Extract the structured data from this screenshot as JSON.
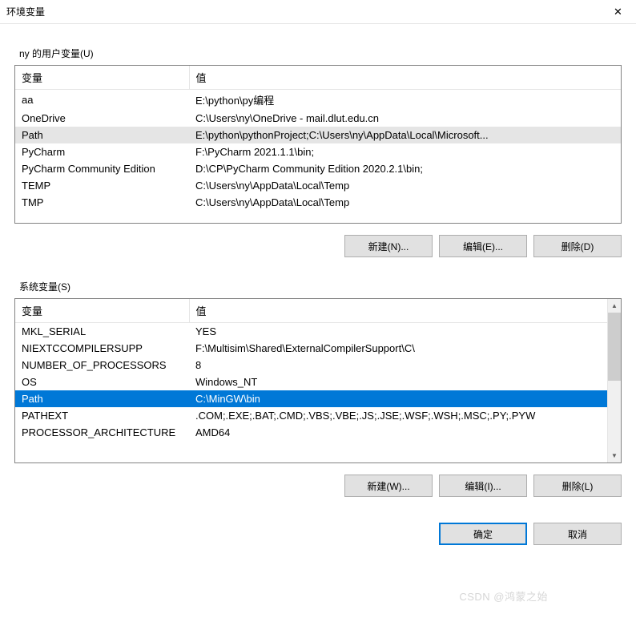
{
  "window": {
    "title": "环境变量"
  },
  "userSection": {
    "label": "ny 的用户变量(U)",
    "headers": {
      "var": "变量",
      "val": "值"
    },
    "rows": [
      {
        "var": "aa",
        "val": "E:\\python\\py编程",
        "selected": false
      },
      {
        "var": "OneDrive",
        "val": "C:\\Users\\ny\\OneDrive - mail.dlut.edu.cn",
        "selected": false
      },
      {
        "var": "Path",
        "val": "E:\\python\\pythonProject;C:\\Users\\ny\\AppData\\Local\\Microsoft...",
        "selected": true
      },
      {
        "var": "PyCharm",
        "val": "F:\\PyCharm 2021.1.1\\bin;",
        "selected": false
      },
      {
        "var": "PyCharm Community Edition",
        "val": "D:\\CP\\PyCharm Community Edition 2020.2.1\\bin;",
        "selected": false
      },
      {
        "var": "TEMP",
        "val": "C:\\Users\\ny\\AppData\\Local\\Temp",
        "selected": false
      },
      {
        "var": "TMP",
        "val": "C:\\Users\\ny\\AppData\\Local\\Temp",
        "selected": false
      }
    ],
    "buttons": {
      "new": "新建(N)...",
      "edit": "编辑(E)...",
      "delete": "删除(D)"
    }
  },
  "sysSection": {
    "label": "系统变量(S)",
    "headers": {
      "var": "变量",
      "val": "值"
    },
    "rows": [
      {
        "var": "MKL_SERIAL",
        "val": "YES",
        "selected": false
      },
      {
        "var": "NIEXTCCOMPILERSUPP",
        "val": "F:\\Multisim\\Shared\\ExternalCompilerSupport\\C\\",
        "selected": false
      },
      {
        "var": "NUMBER_OF_PROCESSORS",
        "val": "8",
        "selected": false
      },
      {
        "var": "OS",
        "val": "Windows_NT",
        "selected": false
      },
      {
        "var": "Path",
        "val": "C:\\MinGW\\bin",
        "selected": true
      },
      {
        "var": "PATHEXT",
        "val": ".COM;.EXE;.BAT;.CMD;.VBS;.VBE;.JS;.JSE;.WSF;.WSH;.MSC;.PY;.PYW",
        "selected": false
      },
      {
        "var": "PROCESSOR_ARCHITECTURE",
        "val": "AMD64",
        "selected": false
      }
    ],
    "buttons": {
      "new": "新建(W)...",
      "edit": "编辑(I)...",
      "delete": "删除(L)"
    }
  },
  "footer": {
    "ok": "确定",
    "cancel": "取消"
  },
  "watermark": "CSDN @鸿蒙之始"
}
